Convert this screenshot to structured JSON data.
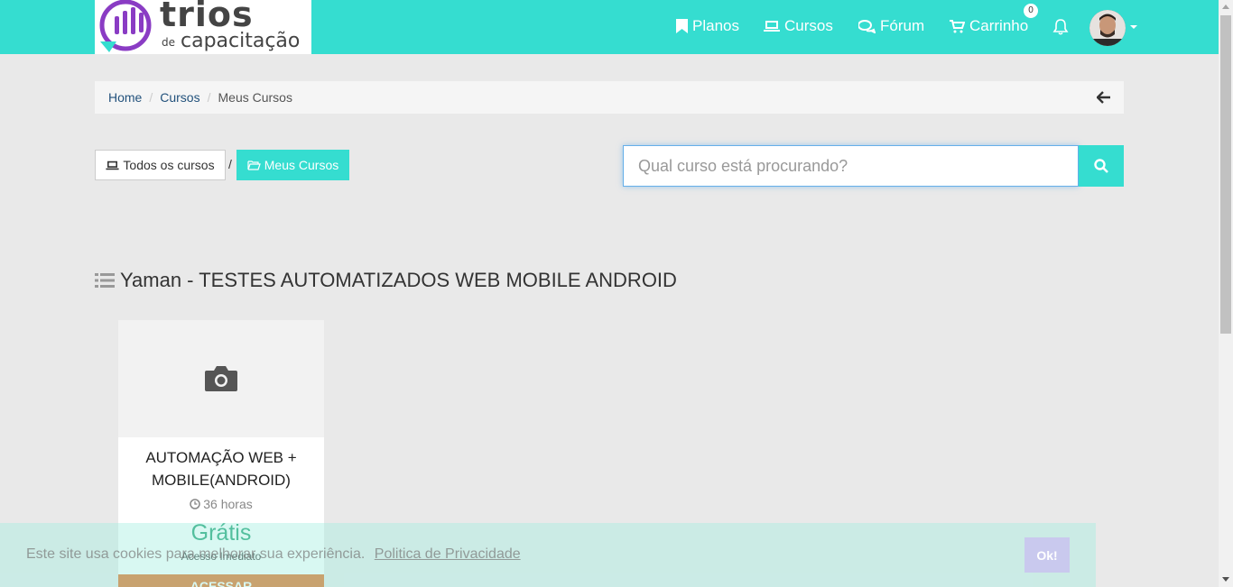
{
  "brand": {
    "logo_line1": "trios",
    "logo_line2_small": "de",
    "logo_line2": "capacitação"
  },
  "nav": {
    "planos": "Planos",
    "cursos": "Cursos",
    "forum": "Fórum",
    "carrinho": "Carrinho",
    "cart_count": "0"
  },
  "breadcrumb": {
    "home": "Home",
    "cursos": "Cursos",
    "current": "Meus Cursos"
  },
  "filters": {
    "all_courses": "Todos os cursos",
    "separator": "/",
    "my_courses": "Meus Cursos"
  },
  "search": {
    "placeholder": "Qual curso está procurando?"
  },
  "section": {
    "title": "Yaman - TESTES AUTOMATIZADOS WEB MOBILE ANDROID"
  },
  "course_card": {
    "title": "AUTOMAÇÃO WEB + MOBILE(ANDROID)",
    "hours": "36 horas",
    "price": "Grátis",
    "access": "Acesso Imediato",
    "cta": "ACESSAR"
  },
  "cookie": {
    "text": "Este site usa cookies para melhorar sua experiência.",
    "link": "Politica de Privacidade",
    "ok": "Ok!"
  },
  "colors": {
    "accent": "#35ddd0",
    "link": "#23527c",
    "price": "#1a9e6e",
    "cta": "#e36b1e"
  }
}
